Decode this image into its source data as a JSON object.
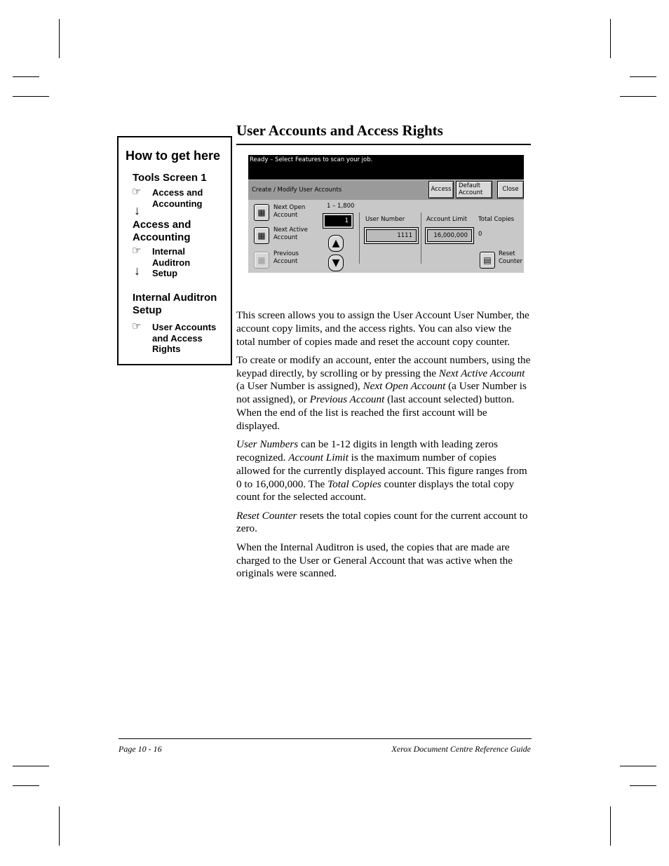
{
  "title": "User Accounts and Access Rights",
  "how_to": {
    "heading": "How to get here",
    "steps": [
      {
        "screen": "Tools Screen 1",
        "press": "Access and Accounting"
      },
      {
        "screen": "Access and Accounting",
        "press": "Internal Auditron Setup"
      },
      {
        "screen": "Internal Auditron Setup",
        "press": "User Accounts and Access Rights"
      }
    ],
    "icons": {
      "press": "pointing-hand-icon",
      "next": "down-arrow-icon"
    }
  },
  "screen": {
    "status": "Ready –  Select Features to scan your job.",
    "bar_label": "Create / Modify User Accounts",
    "buttons": {
      "access": "Access",
      "default_account": "Default Account",
      "close": "Close"
    },
    "next_open": "Next Open Account",
    "next_active": "Next Active Account",
    "previous": "Previous Account",
    "range": "1 – 1,800",
    "account_index": "1",
    "user_number_label": "User Number",
    "user_number": "1111",
    "account_limit_label": "Account Limit",
    "account_limit": "16,000,000",
    "total_copies_label": "Total Copies",
    "total_copies": "0",
    "reset_counter": "Reset Counter"
  },
  "body": [
    [
      {
        "t": "This screen allows you to assign the User Account User Number, the account copy limits, and the access rights. You can also view the total number of copies made and reset the account copy counter."
      }
    ],
    [
      {
        "t": "To create or modify an account, enter the account numbers, using the keypad directly, by scrolling or by pressing the "
      },
      {
        "t": "Next Active Account",
        "i": true
      },
      {
        "t": " (a User Number is assigned), "
      },
      {
        "t": "Next Open Account",
        "i": true
      },
      {
        "t": " (a User Number is not assigned), or "
      },
      {
        "t": "Previous Account",
        "i": true
      },
      {
        "t": " (last account selected) button. When the end of the list is reached the first account will be displayed."
      }
    ],
    [
      {
        "t": "User Numbers",
        "i": true
      },
      {
        "t": " can be 1-12 digits in length with leading zeros recognized. "
      },
      {
        "t": "Account Limit",
        "i": true
      },
      {
        "t": " is the maximum number of copies allowed for the currently displayed account. This figure ranges from 0 to 16,000,000. The "
      },
      {
        "t": "Total Copies",
        "i": true
      },
      {
        "t": " counter displays the total copy count for the selected account."
      }
    ],
    [
      {
        "t": "Reset Counter",
        "i": true
      },
      {
        "t": " resets the total copies count for the current account to zero."
      }
    ],
    [
      {
        "t": "When the Internal Auditron is used, the copies that are made are charged to the User or General Account that was active when the originals were scanned."
      }
    ]
  ],
  "footer": {
    "page": "Page 10 - 16",
    "guide": "Xerox Document Centre Reference Guide"
  }
}
